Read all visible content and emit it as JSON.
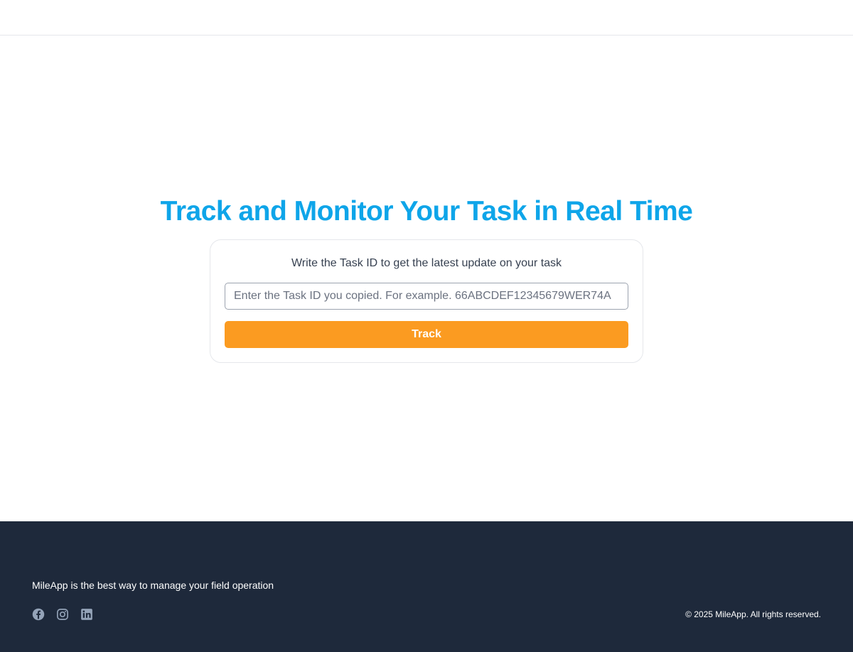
{
  "hero": {
    "title": "Track and Monitor Your Task in Real Time",
    "title_color": "#0ea5e9"
  },
  "track_form": {
    "subtitle": "Write the Task ID to get the latest update on your task",
    "input_value": "",
    "input_placeholder": "Enter the Task ID you copied. For example. 66ABCDEF12345679WER74A",
    "button_label": "Track",
    "button_color": "#fb9b21"
  },
  "footer": {
    "background_color": "#1e293b",
    "tagline": "MileApp is the best way to manage your field operation",
    "social_icons": [
      "facebook-icon",
      "instagram-icon",
      "linkedin-icon"
    ],
    "copyright": "© 2025 MileApp. All rights reserved."
  }
}
